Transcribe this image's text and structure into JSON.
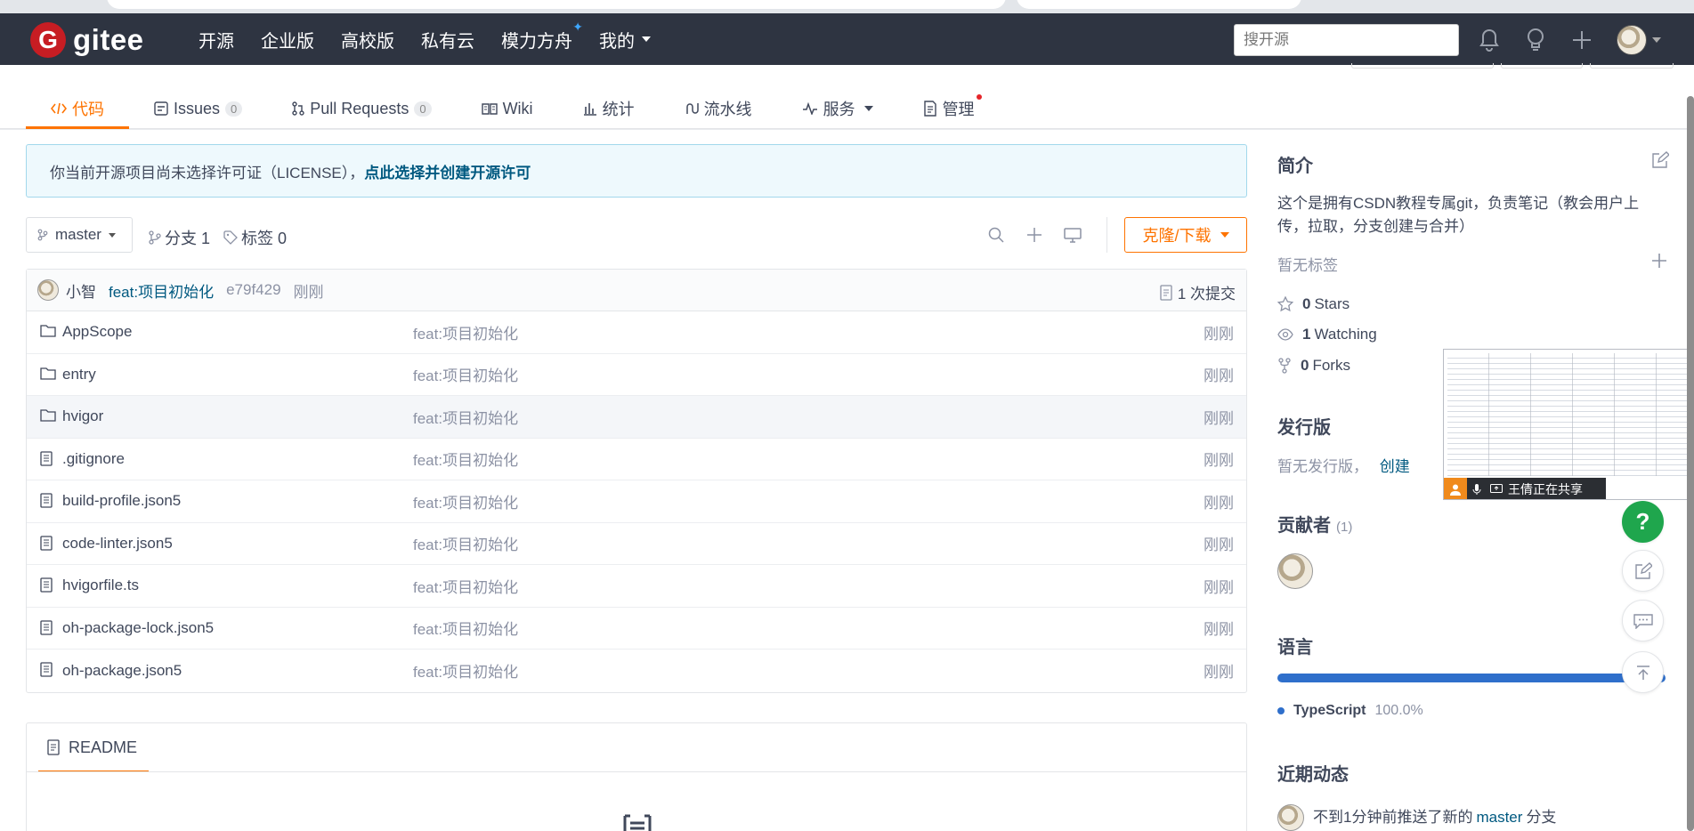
{
  "navbar": {
    "logo_letter": "G",
    "logo_text": "gitee",
    "links": [
      "开源",
      "企业版",
      "高校版",
      "私有云",
      "模力方舟",
      "我的"
    ],
    "search_placeholder": "搜开源"
  },
  "tabs": [
    {
      "label": "代码",
      "icon": "code-icon",
      "active": true
    },
    {
      "label": "Issues",
      "count": "0",
      "icon": "issues-icon"
    },
    {
      "label": "Pull Requests",
      "count": "0",
      "icon": "pull-request-icon"
    },
    {
      "label": "Wiki",
      "icon": "book-icon"
    },
    {
      "label": "统计",
      "icon": "bar-chart-icon"
    },
    {
      "label": "流水线",
      "icon": "pipeline-icon"
    },
    {
      "label": "服务",
      "icon": "pulse-icon"
    },
    {
      "label": "管理",
      "icon": "settings-doc-icon"
    }
  ],
  "license_notice": {
    "text": "你当前开源项目尚未选择许可证（LICENSE），",
    "link": "点此选择并创建开源许可"
  },
  "branch": {
    "current": "master",
    "branches_label": "分支 1",
    "tags_label": "标签 0",
    "clone_label": "克隆/下载"
  },
  "commit": {
    "author": "小智",
    "message": "feat:项目初始化",
    "sha": "e79f429",
    "time": "刚刚",
    "count_label": "1 次提交"
  },
  "files": [
    {
      "name": "AppScope",
      "type": "folder",
      "message": "feat:项目初始化",
      "time": "刚刚"
    },
    {
      "name": "entry",
      "type": "folder",
      "message": "feat:项目初始化",
      "time": "刚刚"
    },
    {
      "name": "hvigor",
      "type": "folder",
      "message": "feat:项目初始化",
      "time": "刚刚"
    },
    {
      "name": ".gitignore",
      "type": "file",
      "message": "feat:项目初始化",
      "time": "刚刚"
    },
    {
      "name": "build-profile.json5",
      "type": "file",
      "message": "feat:项目初始化",
      "time": "刚刚"
    },
    {
      "name": "code-linter.json5",
      "type": "file",
      "message": "feat:项目初始化",
      "time": "刚刚"
    },
    {
      "name": "hvigorfile.ts",
      "type": "file",
      "message": "feat:项目初始化",
      "time": "刚刚"
    },
    {
      "name": "oh-package-lock.json5",
      "type": "file",
      "message": "feat:项目初始化",
      "time": "刚刚"
    },
    {
      "name": "oh-package.json5",
      "type": "file",
      "message": "feat:项目初始化",
      "time": "刚刚"
    }
  ],
  "readme": {
    "label": "README"
  },
  "sidebar": {
    "intro_title": "简介",
    "intro_text": "这个是拥有CSDN教程专属git，负责笔记（教会用户上传，拉取，分支创建与合并）",
    "no_tags": "暂无标签",
    "stars": {
      "count": "0",
      "label": "Stars"
    },
    "watching": {
      "count": "1",
      "label": "Watching"
    },
    "forks": {
      "count": "0",
      "label": "Forks"
    },
    "release_title": "发行版",
    "release_text": "暂无发行版，",
    "release_link": "创建",
    "contributors_title": "贡献者",
    "contributors_count": "(1)",
    "language_title": "语言",
    "language_name": "TypeScript",
    "language_percent": "100.0%",
    "activity_title": "近期动态",
    "activity_text_prefix": "不到1分钟前推送了新的",
    "activity_branch": "master",
    "activity_text_suffix": "分支"
  },
  "share_overlay": {
    "label": "王倩正在共享"
  },
  "help_label": "?",
  "colors": {
    "navbar": "#2e3441",
    "accent": "#fe7300",
    "link": "#005980",
    "language": "#2f6fcb",
    "help": "#1fa64d"
  }
}
